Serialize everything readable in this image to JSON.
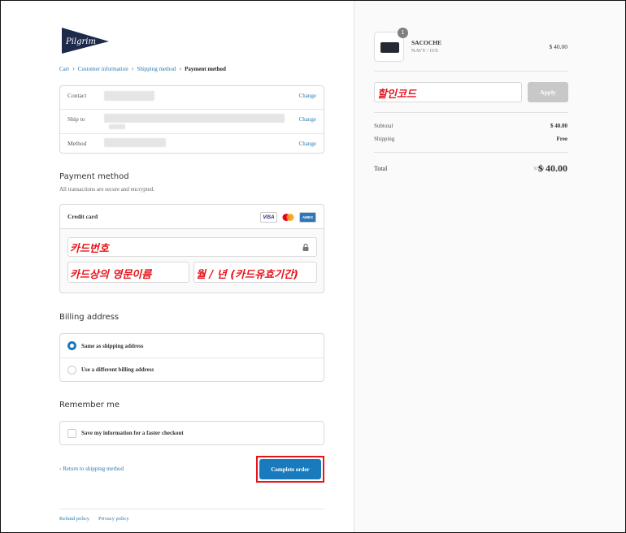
{
  "brand": {
    "logo_text": "Pilgrim"
  },
  "breadcrumb": {
    "cart": "Cart",
    "customer": "Customer information",
    "shipping": "Shipping method",
    "payment": "Payment method",
    "separator": "›"
  },
  "review": {
    "contact_label": "Contact",
    "ship_label": "Ship to",
    "method_label": "Method",
    "change": "Change"
  },
  "payment": {
    "title": "Payment method",
    "subtitle": "All transactions are secure and encrypted.",
    "credit_card": "Credit card",
    "cards": [
      "VISA",
      "AMEX"
    ],
    "card_number_annotation": "카드번호",
    "name_annotation": "카드상의 영문이름",
    "expiry_annotation": "월 / 년 (카드유효기간)"
  },
  "billing": {
    "title": "Billing address",
    "same": "Same as shipping address",
    "different": "Use a different billing address"
  },
  "remember": {
    "title": "Remember me",
    "save": "Save my information for a faster checkout"
  },
  "actions": {
    "return": "Return to shipping method",
    "complete": "Complete order"
  },
  "footer": {
    "refund": "Refund policy",
    "privacy": "Privacy policy"
  },
  "order": {
    "qty": "1",
    "name": "SACOCHE",
    "variant": "NAVY / O/S",
    "price": "$ 40.00",
    "discount_annotation": "할인코드",
    "apply": "Apply",
    "subtotal_label": "Subtotal",
    "subtotal": "$ 40.00",
    "shipping_label": "Shipping",
    "shipping": "Free",
    "total_label": "Total",
    "currency": "USD",
    "total": "$ 40.00"
  },
  "colors": {
    "accent": "#197bbd",
    "link": "#2a7ab0",
    "annotation": "#e8141b"
  }
}
